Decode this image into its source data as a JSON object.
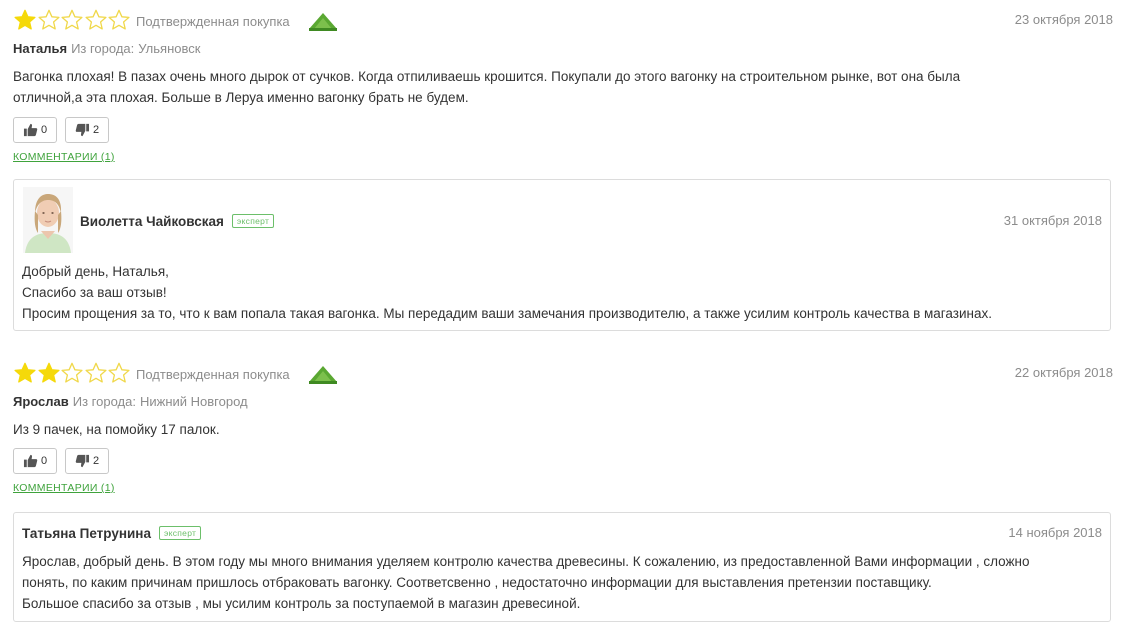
{
  "colors": {
    "star_filled": "#f5d90a",
    "star_empty_outline": "#f0d84a",
    "accent_green": "#3fa33c",
    "muted_text": "#8c8c8c"
  },
  "reviews": [
    {
      "rating": 1,
      "max_rating": 5,
      "verified_label": "Подтвержденная покупка",
      "store_logo": "leroy-merlin-logo",
      "date": "23 октября 2018",
      "author": "Наталья",
      "from_label": "Из города:",
      "city": "Ульяновск",
      "text_lines": [
        "Вагонка плохая! В пазах очень много дырок от сучков. Когда отпиливаешь крошится. Покупали до этого вагонку на строительном рынке, вот она была",
        "отличной,а эта плохая. Больше в Леруа именно вагонку брать не будем."
      ],
      "likes": "0",
      "dislikes": "2",
      "comments_link": "КОММЕНТАРИИ (1)",
      "reply": {
        "author": "Виолетта Чайковская",
        "badge": "эксперт",
        "date": "31 октября 2018",
        "has_avatar": true,
        "text_lines": [
          "Добрый день, Наталья,",
          "Спасибо за ваш отзыв!",
          "Просим прощения за то, что к вам попала такая вагонка. Мы передадим ваши замечания производителю, а также усилим контроль качества в магазинах."
        ]
      }
    },
    {
      "rating": 2,
      "max_rating": 5,
      "verified_label": "Подтвержденная покупка",
      "store_logo": "leroy-merlin-logo",
      "date": "22 октября 2018",
      "author": "Ярослав",
      "from_label": "Из города:",
      "city": "Нижний Новгород",
      "text_lines": [
        "Из 9 пачек, на помойку 17 палок."
      ],
      "likes": "0",
      "dislikes": "2",
      "comments_link": "КОММЕНТАРИИ (1)",
      "reply": {
        "author": "Татьяна Петрунина",
        "badge": "эксперт",
        "date": "14 ноября 2018",
        "has_avatar": false,
        "text_lines": [
          "Ярослав, добрый день. В этом году мы много внимания уделяем контролю качества древесины. К сожалению, из предоставленной Вами информации , сложно",
          "понять, по каким причинам пришлось отбраковать вагонку. Соответсвенно , недостаточно информации для выставления претензии поставщику.",
          "Большое спасибо за отзыв , мы усилим контроль за поступаемой в магазин древесиной."
        ]
      }
    }
  ]
}
